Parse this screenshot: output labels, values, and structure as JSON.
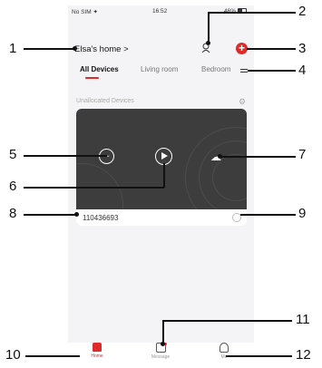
{
  "status_bar": {
    "carrier": "No SIM ✦",
    "time": "16:52",
    "battery": "46%"
  },
  "header": {
    "home_title": "Elsa's home >",
    "add_symbol": "+"
  },
  "tabs": [
    {
      "label": "All Devices",
      "active": true
    },
    {
      "label": "Living room",
      "active": false
    },
    {
      "label": "Bedroom",
      "active": false
    }
  ],
  "section": {
    "label": "Unallocated Devices"
  },
  "device": {
    "id": "110436693",
    "sleep_glyph": "ᵕᵕ"
  },
  "nav": {
    "home_label": "Home",
    "message_label": "Message",
    "me_label": "Me"
  },
  "callouts": [
    "1",
    "2",
    "3",
    "4",
    "5",
    "6",
    "7",
    "8",
    "9",
    "10",
    "11",
    "12"
  ],
  "colors": {
    "accent": "#e02a2a",
    "card_bg": "#3d3d3d"
  }
}
